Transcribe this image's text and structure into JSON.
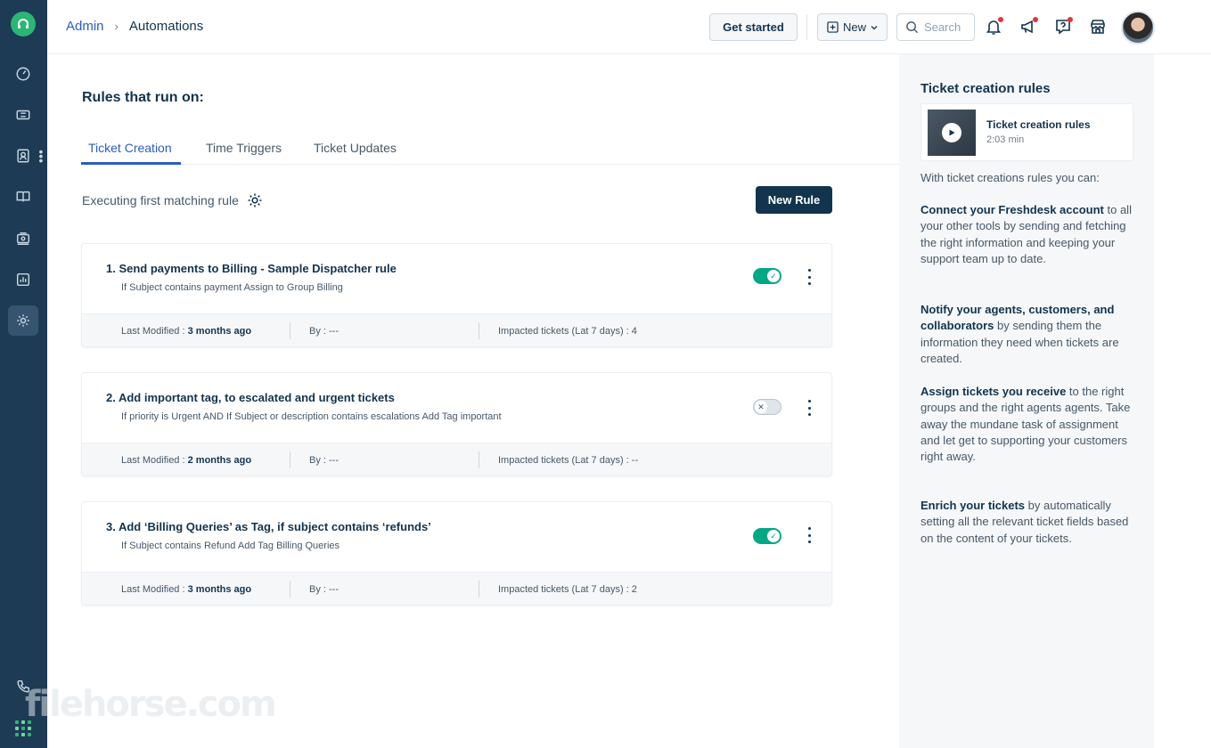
{
  "breadcrumb": {
    "admin": "Admin",
    "separator": "›",
    "current": "Automations"
  },
  "header": {
    "get_started": "Get started",
    "new_label": "New",
    "search_placeholder": "Search"
  },
  "sidebar": {
    "items": [
      "dashboard-icon",
      "tickets-icon",
      "contacts-icon",
      "solutions-icon",
      "groups-icon",
      "analytics-icon",
      "admin-gear-icon"
    ],
    "active": "admin-gear-icon"
  },
  "main": {
    "heading": "Rules that run on:",
    "tabs": [
      "Ticket Creation",
      "Time Triggers",
      "Ticket Updates"
    ],
    "active_tab": "Ticket Creation",
    "execution_label": "Executing first matching rule",
    "new_rule_label": "New Rule",
    "rules": [
      {
        "title": "1.  Send payments to Billing - Sample Dispatcher rule",
        "description": "If Subject contains payment Assign to Group Billing",
        "enabled": true,
        "last_modified_label": "Last Modified :",
        "last_modified": "3 months ago",
        "by": "By : ---",
        "impacted": "Impacted tickets (Lat 7 days) : 4"
      },
      {
        "title": "2.  Add important tag, to escalated and urgent tickets",
        "description": "If priority is Urgent AND If Subject or description contains escalations Add Tag important",
        "enabled": false,
        "last_modified_label": "Last Modified :",
        "last_modified": "2 months ago",
        "by": "By : ---",
        "impacted": "Impacted tickets (Lat 7 days) : --"
      },
      {
        "title": "3.  Add ‘Billing Queries’ as Tag, if subject contains ‘refunds’",
        "description": "If Subject contains Refund Add Tag Billing Queries",
        "enabled": true,
        "last_modified_label": "Last Modified :",
        "last_modified": "3 months ago",
        "by": "By : ---",
        "impacted": "Impacted tickets (Lat 7 days) : 2"
      }
    ]
  },
  "panel": {
    "title": "Ticket creation rules",
    "video_title": "Ticket creation rules",
    "video_duration": "2:03 min",
    "intro": "With ticket creations rules you can:",
    "points": [
      {
        "bold": "Connect your Freshdesk account",
        "rest": " to all your other tools by sending and fetching the right information and keeping your support team up to date."
      },
      {
        "bold": "Notify your agents, customers, and collaborators",
        "rest": " by sending them the information they need when tickets are created."
      },
      {
        "bold": "Assign tickets you receive",
        "rest": " to the right groups and the right agents agents. Take away the mundane task of assignment and let get to supporting your customers right away."
      },
      {
        "bold": "Enrich your tickets",
        "rest": " by automatically setting all the relevant ticket fields based on the content of your tickets."
      }
    ]
  },
  "watermark": "filehorse.com",
  "colors": {
    "sidebar": "#1d3b54",
    "accent": "#2c5cc5",
    "toggle_on": "#00a886",
    "primary_button": "#12344d"
  }
}
